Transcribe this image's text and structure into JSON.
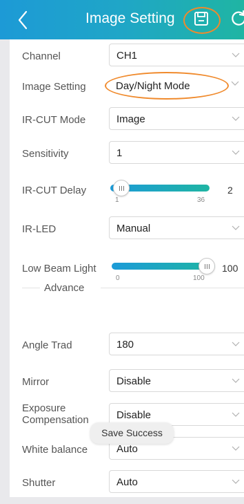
{
  "header": {
    "title": "Image Setting",
    "accent_gradient": [
      "#1d9ad6",
      "#1fb5a3"
    ],
    "highlight_color": "#f08a2c",
    "icons": [
      "back-chevron-icon",
      "save-floppy-icon",
      "refresh-icon"
    ]
  },
  "rows": {
    "channel": {
      "label": "Channel",
      "value": "CH1"
    },
    "image_setting": {
      "label": "Image Setting",
      "value": "Day/Night Mode"
    },
    "ircut_mode": {
      "label": "IR-CUT Mode",
      "value": "Image"
    },
    "sensitivity": {
      "label": "Sensitivity",
      "value": "1"
    },
    "ircut_delay": {
      "label": "IR-CUT Delay",
      "min": "1",
      "max": "36",
      "value": "2",
      "fraction": 0.03
    },
    "irled": {
      "label": "IR-LED",
      "value": "Manual"
    },
    "low_beam": {
      "label": "Low Beam Light",
      "min": "0",
      "max": "100",
      "value": "100",
      "fraction": 1.0
    }
  },
  "advance": {
    "label": "Advance",
    "angle_trad": {
      "label": "Angle Trad",
      "value": "180"
    },
    "mirror": {
      "label": "Mirror",
      "value": "Disable"
    },
    "exposure": {
      "label": "Exposure Compensation",
      "value": "Disable"
    },
    "white_balance": {
      "label": "White balance",
      "value": "Auto"
    },
    "shutter": {
      "label": "Shutter",
      "value": "Auto"
    }
  },
  "toast": {
    "text": "Save Success"
  }
}
